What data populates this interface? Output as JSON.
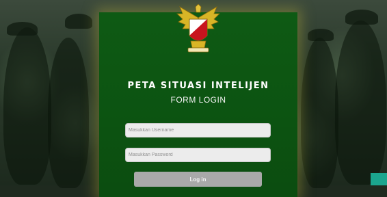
{
  "login": {
    "app_title": "PETA SITUASI INTELIJEN",
    "form_title": "FORM LOGIN",
    "username_placeholder": "Masukkan Username",
    "password_placeholder": "Masukkan Password",
    "button_label": "Log in"
  },
  "colors": {
    "panel": "#0c5311",
    "panel_glow": "#c8be3c",
    "button": "#a9a9a9",
    "accent_corner": "#1ba58e"
  },
  "icons": {
    "emblem": "military-eagle-emblem-icon"
  }
}
